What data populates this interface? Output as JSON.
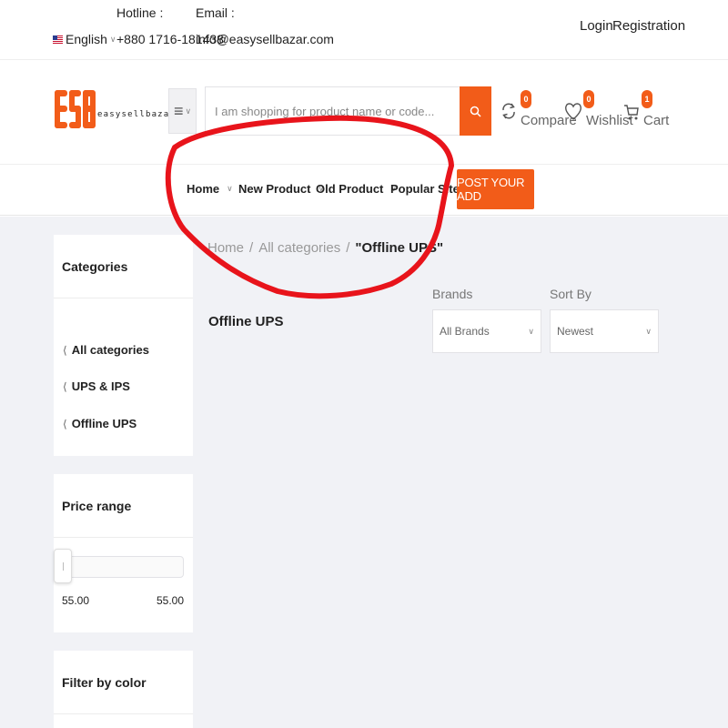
{
  "topbar": {
    "hotline_label": "Hotline :",
    "email_label": "Email :",
    "language": "English",
    "phone": "+880 1716-181438",
    "email": "info@easysellbazar.com",
    "login": "Login",
    "registration": "Registration"
  },
  "header": {
    "logo_text": "easysellbazar",
    "search_placeholder": "I am shopping for product name or code...",
    "compare": {
      "label": "Compare",
      "count": "0"
    },
    "wishlist": {
      "label": "Wishlist",
      "count": "0"
    },
    "cart": {
      "label": "Cart",
      "count": "1"
    }
  },
  "nav": {
    "items": [
      "Home",
      "New Product",
      "Old Product",
      "Popular Site"
    ],
    "post_button": "POST YOUR ADD"
  },
  "sidebar": {
    "categories_title": "Categories",
    "categories": [
      "All categories",
      "UPS & IPS",
      "Offline UPS"
    ],
    "price_title": "Price range",
    "price_min": "55.00",
    "price_max": "55.00",
    "color_title": "Filter by color"
  },
  "content": {
    "breadcrumb": [
      "Home",
      "All categories"
    ],
    "breadcrumb_current": "\"Offline UPS\"",
    "breadcrumb_sep": "/",
    "page_title": "Offline UPS",
    "brands_label": "Brands",
    "brands_value": "All Brands",
    "sort_label": "Sort By",
    "sort_value": "Newest"
  },
  "colors": {
    "accent": "#f25c19",
    "annotation": "#e8141b",
    "background": "#f1f2f6"
  }
}
